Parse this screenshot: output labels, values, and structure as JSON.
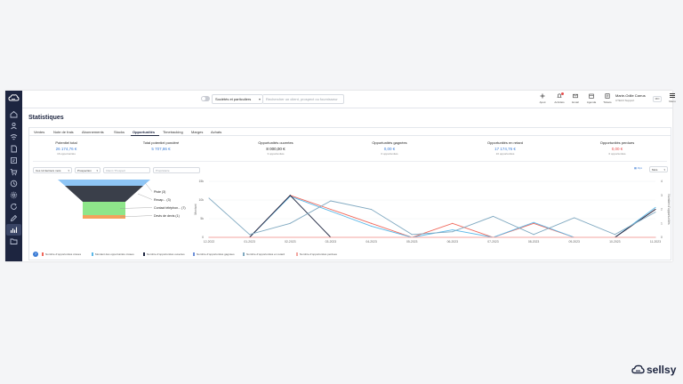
{
  "topbar": {
    "scope_select": "Sociétés et particuliers",
    "search_placeholder": "Rechercher un client, prospect ou fournisseur",
    "actions": [
      {
        "label": "Ajout",
        "icon": "plus-icon"
      },
      {
        "label": "Activités",
        "icon": "bell-icon"
      },
      {
        "label": "Email",
        "icon": "mail-icon"
      },
      {
        "label": "Agenda",
        "icon": "calendar-icon"
      },
      {
        "label": "Tickets",
        "icon": "ticket-icon"
      }
    ],
    "user_name": "Marie-Odile Carrus",
    "user_company": "CTEC3 Support",
    "user_badge": "MO",
    "menu_label": "Menu"
  },
  "sidebar": {
    "icons": [
      "home-icon",
      "contacts-icon",
      "pipeline-icon",
      "documents-icon",
      "invoices-icon",
      "cart-icon",
      "timesheet-icon",
      "settings-icon",
      "refresh-icon",
      "edit-icon",
      "statistics-icon",
      "folder-icon"
    ],
    "active": "statistics-icon"
  },
  "page": {
    "title": "Statistiques",
    "tabs": [
      "Ventes",
      "Note de frais",
      "Abonnements",
      "Stocks",
      "Opportunités",
      "Timetracking",
      "Marges",
      "Achats"
    ],
    "active_tab": "Opportunités"
  },
  "kpis": [
    {
      "title": "Potentiel total",
      "value": "26 174,76 €",
      "sub": "16 opportunités",
      "color": "#3a7bd5"
    },
    {
      "title": "Total potentiel pondéré",
      "value": "5 707,86 €",
      "sub": "",
      "color": "#3a7bd5"
    },
    {
      "title": "Opportunités ouvertes",
      "value": "8 000,00 €",
      "sub": "3 opportunités",
      "color": "#222222"
    },
    {
      "title": "Opportunités gagnées",
      "value": "0,00 €",
      "sub": "0 opportunités",
      "color": "#3a7bd5"
    },
    {
      "title": "Opportunités en retard",
      "value": "17 174,76 €",
      "sub": "10 opportunités",
      "color": "#3a7bd5"
    },
    {
      "title": "Opportunités perdues",
      "value": "0,00 €",
      "sub": "0 opportunités",
      "color": "#e54b4b"
    }
  ],
  "filters": {
    "period": "Ces 12 derniers mois",
    "pipeline": "Prospection",
    "client_placeholder": "Client / Prospect",
    "owner_placeholder": "Propriétaire",
    "options_link": "Opt.",
    "granularity": "Mois"
  },
  "funnel": [
    {
      "label": "Piste (3)",
      "color": "#8ec5f5"
    },
    {
      "label": "Recap... (3)",
      "color": "#3a3f4a"
    },
    {
      "label": "Contact téléphon... (7)",
      "color": "#8ee68a"
    },
    {
      "label": "Devis de devis (1)",
      "color": "#f4a25c"
    }
  ],
  "chart_data": {
    "type": "line",
    "x": [
      "12-2022",
      "01-2023",
      "02-2023",
      "03-2023",
      "04-2023",
      "05-2023",
      "06-2023",
      "07-2023",
      "08-2023",
      "09-2023",
      "10-2023",
      "11-2023"
    ],
    "ylabel_left": "Montant",
    "ylabel_right": "Nombre d'opportunités",
    "yticks_left": [
      "15k",
      "10k",
      "5k",
      "0"
    ],
    "yticks_right": [
      "4",
      "3",
      "2",
      "1",
      "0"
    ],
    "ylim_left": [
      0,
      15000
    ],
    "ylim_right": [
      0,
      4
    ],
    "series": [
      {
        "name": "Nombre d'opportunités créées",
        "color": "#f0675a",
        "axis": "right",
        "values": [
          0,
          0,
          3,
          2,
          1,
          0,
          1,
          0,
          1,
          0,
          0,
          2
        ]
      },
      {
        "name": "Montant des opportunités créées",
        "color": "#5bb8e8",
        "axis": "left",
        "values": [
          0,
          0,
          11000,
          7000,
          3000,
          0,
          2000,
          0,
          4000,
          0,
          0,
          8000
        ]
      },
      {
        "name": "Nombre d'opportunités ouvertes",
        "color": "#1d2540",
        "axis": "right",
        "values": [
          0,
          0,
          3,
          0,
          0,
          0,
          0,
          0,
          0,
          0,
          0,
          2
        ]
      },
      {
        "name": "Nombre d'opportunités gagnées",
        "color": "#6c8fd8",
        "axis": "right",
        "values": [
          0,
          0,
          0,
          0,
          0,
          0,
          0,
          0,
          0,
          0,
          0,
          0
        ]
      },
      {
        "name": "Nombre d'opportunités en retard",
        "color": "#7fa8c0",
        "axis": "right",
        "values": [
          2.8,
          0.2,
          1,
          2.6,
          2,
          0.2,
          0.4,
          1.5,
          0.2,
          1.4,
          0.2,
          1.8
        ]
      },
      {
        "name": "Nombre d'opportunités perdues",
        "color": "#f3a6a0",
        "axis": "right",
        "values": [
          0,
          0,
          0,
          0,
          0,
          0,
          0,
          0,
          0,
          0,
          0,
          0
        ]
      }
    ]
  },
  "brand": {
    "name": "sellsy"
  }
}
